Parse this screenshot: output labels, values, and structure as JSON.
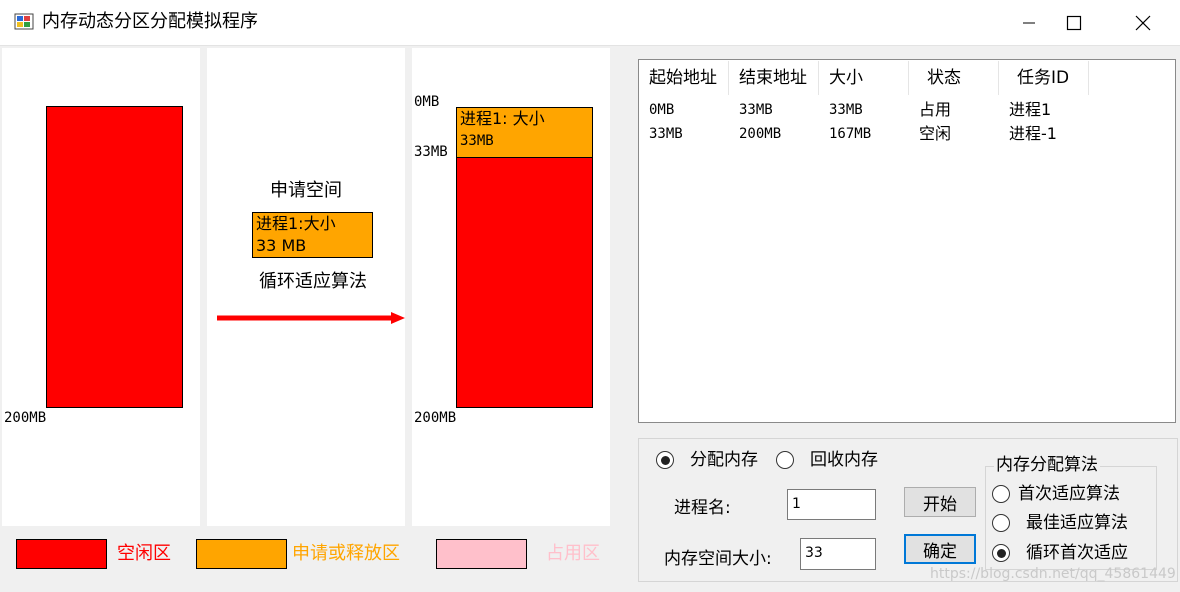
{
  "window": {
    "title": "内存动态分区分配模拟程序"
  },
  "panel_before": {
    "bottom_label": "200MB"
  },
  "panel_middle": {
    "action_label": "申请空间",
    "request_box": {
      "line1": "进程1:大小",
      "line2": "33 MB"
    },
    "algorithm_label": "循环适应算法"
  },
  "panel_after": {
    "label_top": "0MB",
    "label_split": "33MB",
    "label_bottom": "200MB",
    "block": {
      "line1": "进程1: 大小",
      "line2": "33MB"
    }
  },
  "legend": [
    {
      "label": "空闲区",
      "color": "#ff0000"
    },
    {
      "label": "申请或释放区",
      "color": "#ffa500"
    },
    {
      "label": "占用区",
      "color": "#ffc0cb"
    }
  ],
  "table": {
    "columns": [
      "起始地址",
      "结束地址",
      "大小",
      "状态",
      "任务ID"
    ],
    "rows": [
      [
        "0MB",
        "33MB",
        "33MB",
        "占用",
        "进程1"
      ],
      [
        "33MB",
        "200MB",
        "167MB",
        "空闲",
        "进程-1"
      ]
    ]
  },
  "controls": {
    "allocate_label": "分配内存",
    "reclaim_label": "回收内存",
    "process_name_label": "进程名:",
    "process_name_value": "1",
    "memory_size_label": "内存空间大小:",
    "memory_size_value": "33",
    "start_label": "开始",
    "confirm_label": "确定"
  },
  "algorithm_group": {
    "title": "内存分配算法",
    "options": [
      "首次适应算法",
      "最佳适应算法",
      "循环首次适应"
    ]
  },
  "watermark": "https://blog.csdn.net/qq_45861449"
}
